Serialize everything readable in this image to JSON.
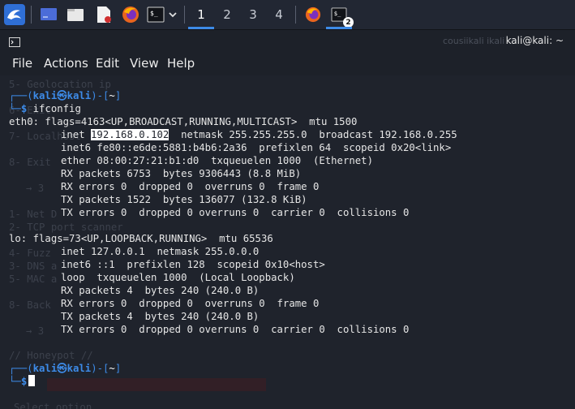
{
  "taskbar": {
    "workspaces": [
      "1",
      "2",
      "3",
      "4"
    ],
    "active_workspace": "1",
    "terminal_window_count": "2"
  },
  "window": {
    "title": "kali@kali: ~",
    "title_ghost": "cousiikali ikali"
  },
  "menu": {
    "items": [
      "File",
      "Actions",
      "Edit",
      "View",
      "Help"
    ]
  },
  "terminal": {
    "user": "kali",
    "at": "㉿",
    "host": "kali",
    "cwd": "~",
    "command": "ifconfig",
    "eth0": {
      "header": "eth0: flags=4163<UP,BROADCAST,RUNNING,MULTICAST>  mtu 1500",
      "inet_label": "inet ",
      "ip": "192.168.0.102",
      "inet_rest": "  netmask 255.255.255.0  broadcast 192.168.0.255",
      "lines": [
        "inet6 fe80::e6de:5881:b4b6:2a36  prefixlen 64  scopeid 0x20<link>",
        "ether 08:00:27:21:b1:d0  txqueuelen 1000  (Ethernet)",
        "RX packets 6753  bytes 9306443 (8.8 MiB)",
        "RX errors 0  dropped 0  overruns 0  frame 0",
        "TX packets 1522  bytes 136077 (132.8 KiB)",
        "TX errors 0  dropped 0 overruns 0  carrier 0  collisions 0"
      ]
    },
    "lo": {
      "header": "lo: flags=73<UP,LOOPBACK,RUNNING>  mtu 65536",
      "lines": [
        "inet 127.0.0.1  netmask 255.0.0.0",
        "inet6 ::1  prefixlen 128  scopeid 0x10<host>",
        "loop  txqueuelen 1000  (Local Loopback)",
        "RX packets 4  bytes 240 (240.0 B)",
        "RX errors 0  dropped 0  overruns 0  frame 0",
        "TX packets 4  bytes 240 (240.0 B)",
        "TX errors 0  dropped 0 overruns 0  carrier 0  collisions 0"
      ]
    },
    "background_ghost": [
      "5- Geolocation ip",
      "6- Exit",
      "7- Localhost",
      "8- Exit",
      "→ 3",
      "1- Net D",
      "2- TCP port scanner",
      "4- Fuzz",
      "3- DNS a",
      "5- MAC a",
      "8- Back",
      "→ 3",
      "// Honeypot //",
      "Select option"
    ]
  }
}
